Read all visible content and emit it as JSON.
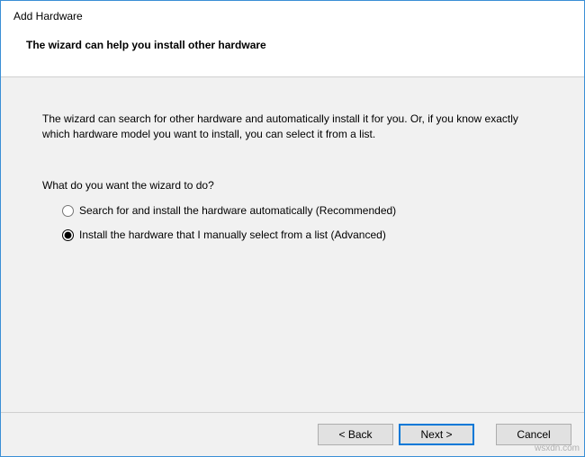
{
  "window": {
    "title": "Add Hardware",
    "subtitle": "The wizard can help you install other hardware"
  },
  "content": {
    "description": "The wizard can search for other hardware and automatically install it for you. Or, if you know exactly which hardware model you want to install, you can select it from a list.",
    "question": "What do you want the wizard to do?",
    "options": [
      {
        "label": "Search for and install the hardware automatically (Recommended)",
        "selected": false
      },
      {
        "label": "Install the hardware that I manually select from a list (Advanced)",
        "selected": true
      }
    ]
  },
  "footer": {
    "back": "< Back",
    "next": "Next >",
    "cancel": "Cancel"
  },
  "watermark": "wsxdn.com"
}
